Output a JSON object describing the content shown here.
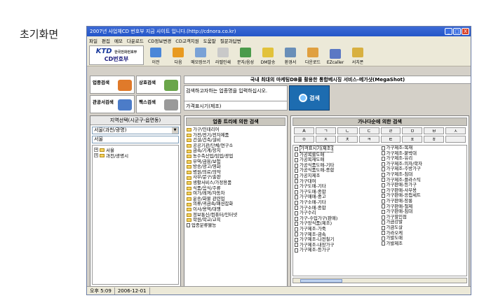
{
  "caption": "초기화면",
  "window": {
    "title": "2007년 사업체CD 번호부 지금 사이트 입니다.(http://cdnora.co.kr)",
    "controls": [
      "_",
      "□",
      "X"
    ]
  },
  "menu": [
    "파일",
    "편집",
    "메모",
    "다운로드",
    "CD정보변경",
    "CD고객지원",
    "도움말",
    "질문과답변"
  ],
  "logo": {
    "brand_k": "KTD",
    "brand_sub": "한국전화번호부",
    "name": "CD번호부"
  },
  "toolbar": [
    {
      "label": "이전",
      "color": "#4a86d8"
    },
    {
      "label": "다음",
      "color": "#e89a20"
    },
    {
      "label": "메모장쓰기",
      "color": "#7aa2d6"
    },
    {
      "label": "라벨인쇄",
      "color": "#c9c9c9"
    },
    {
      "label": "문자/음성",
      "color": "#4b9b4b"
    },
    {
      "label": "DM발송",
      "color": "#e2c23a"
    },
    {
      "label": "환경서",
      "color": "#6a8fb8"
    },
    {
      "label": "다운로드",
      "color": "#e0a040"
    },
    {
      "label": "EZcaller",
      "color": "#5b78c4"
    },
    {
      "label": "서치폰",
      "color": "#d8b040"
    }
  ],
  "left_buttons": [
    {
      "label": "업종검색",
      "color": "#e07a2a"
    },
    {
      "label": "상호검색",
      "color": "#6aa64a"
    },
    {
      "label": "관공서검색",
      "color": "#4c7cc8"
    },
    {
      "label": "팩스검색",
      "color": "#9a9a9a"
    }
  ],
  "banner": "국내 최대의 마케팅DB를 활용한 통합베시징 서비스-메가샷(MegaShot)",
  "search": {
    "hint": "검색하고자하는 업종명을 입력하십시오.",
    "value": "가격표시기(제조)",
    "button": "검색"
  },
  "region": {
    "header": "지역선택(시군구-읍면동)",
    "select": "서울(과천/광명)",
    "input": "서울",
    "tree": [
      "서울",
      "과천/광명시"
    ]
  },
  "tree_panel": {
    "header": "업종 트리에 의한 검색",
    "items": [
      "가구/인테리어",
      "가전/전기/전자제품",
      "건설/건축/설비",
      "공공기관/단체/연구소",
      "금속/기계/장치",
      "농수축산업/임업/광업",
      "무역/금융/보험",
      "방송/광고/영화",
      "병원/의료/의약",
      "사무/문구/출판",
      "생활서비스/가정용품",
      "식품/음식/주류",
      "여가/레져/자동차",
      "운송/화물 관련업",
      "의류/귀금속/패션잡화",
      "이사/용역/대행",
      "정보통신/컴퓨터/인터넷",
      "학원/학교/교육",
      "업종분류불능"
    ]
  },
  "alpha_panel": {
    "header": "가나다순에 의한 검색",
    "keys_row1": [
      "A",
      "ㄱ",
      "ㄴ",
      "ㄷ",
      "ㄹ",
      "ㅁ",
      "ㅂ",
      "ㅅ"
    ],
    "keys_row2": [
      "ㅇ",
      "ㅈ",
      "ㅊ",
      "ㅋ",
      "ㅌ",
      "ㅍ",
      "ㅎ",
      ""
    ],
    "col1": [
      "가격표시기(제조)",
      "가공목물도매",
      "가공목재도매",
      "가공식품도매-기타",
      "가공식품도매-종합",
      "가공지제조",
      "가구대여",
      "가구도매-기타",
      "가구도매-종합",
      "가구매매-중고",
      "가구소매-기타",
      "가구소매-종합",
      "가구수리",
      "가구-수입가구(판매)",
      "가구장식품(제조)",
      "가구제조-가죽",
      "가구제조-금속",
      "가구제조-나전칠기",
      "가구제조-내장가구",
      "가구제조-등가구"
    ],
    "col2": [
      "가구제조-목재",
      "가구제조-붙박대",
      "가구제조-유리",
      "가구제조-의자/학자",
      "가구제조-주방가구",
      "가구제조-침대",
      "가구제조-플라스틱",
      "가구판매-등가구",
      "가구판매-사무용",
      "가구판매-응접세트",
      "가구판매-장롱",
      "가구판매-절제",
      "가구판매-침대",
      "가구할인점",
      "가금강발",
      "가금도살",
      "가라오케",
      "가발도매",
      "가발제조",
      ""
    ]
  },
  "status": {
    "time": "오후 5:09",
    "date": "2006-12-01"
  }
}
